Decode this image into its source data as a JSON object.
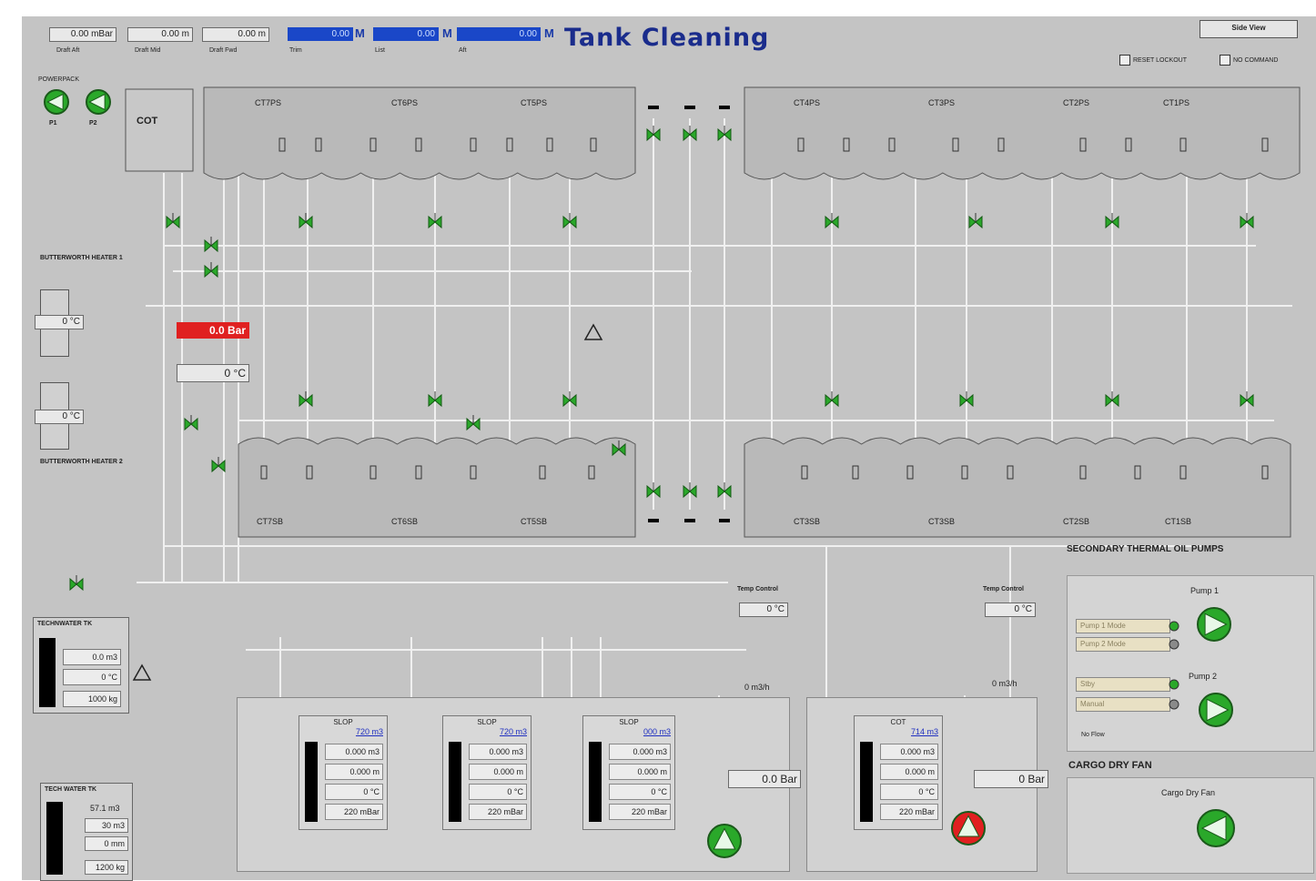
{
  "title": "Tank Cleaning",
  "header": {
    "draft_fields": [
      {
        "value": "0.00 mBar",
        "label": "Draft Aft"
      },
      {
        "value": "0.00 m",
        "label": "Draft Mid"
      },
      {
        "value": "0.00 m",
        "label": "Draft Fwd"
      }
    ],
    "trim_bars": [
      {
        "value": "0.00",
        "unit": "M",
        "label": "Trim"
      },
      {
        "value": "0.00",
        "unit": "M",
        "label": "List"
      },
      {
        "value": "0.00",
        "unit": "M",
        "label": "Aft"
      }
    ],
    "side_view_button": "Side View",
    "reset_lockout": "RESET LOCKOUT",
    "no_command": "NO COMMAND"
  },
  "powerpack": {
    "label": "POWERPACK",
    "pumps": [
      "P1",
      "P2"
    ]
  },
  "cot_label": "COT",
  "upper_tanks": [
    "CT7PS",
    "CT6PS",
    "CT5PS",
    "CT4PS",
    "CT3PS",
    "CT2PS",
    "CT1PS"
  ],
  "lower_tanks": [
    "CT7SB",
    "CT6SB",
    "CT5SB",
    "CT3SB",
    "CT3SB",
    "CT2SB",
    "CT1SB"
  ],
  "butterworth_1": {
    "title": "BUTTERWORTH HEATER 1",
    "temp": "0 °C"
  },
  "butterworth_2": {
    "title": "BUTTERWORTH HEATER 2",
    "temp": "0 °C"
  },
  "pressure_alarm": "0.0 Bar",
  "temp_reading": "0 °C",
  "tech_water_tank": {
    "title": "TECHNWATER TK",
    "values": [
      "0.0 m3",
      "0 °C",
      "1000 kg"
    ]
  },
  "tech_water_tank_2": {
    "title": "TECH WATER TK",
    "values": [
      "57.1 m3",
      "30 m3",
      "0 mm",
      "1200 kg"
    ]
  },
  "temp_control_1": {
    "label": "Temp Control",
    "value": "0 °C"
  },
  "temp_control_2": {
    "label": "Temp Control",
    "value": "0 °C"
  },
  "flow_1": "0 m3/h",
  "flow_2": "0 m3/h",
  "slop_tanks": [
    {
      "name": "SLOP",
      "volume": "720 m3",
      "values": [
        "0.000 m3",
        "0.000 m",
        "0 °C",
        "220 mBar"
      ]
    },
    {
      "name": "SLOP",
      "volume": "720 m3",
      "values": [
        "0.000 m3",
        "0.000 m",
        "0 °C",
        "220 mBar"
      ]
    },
    {
      "name": "SLOP",
      "volume": "000 m3",
      "values": [
        "0.000 m3",
        "0.000 m",
        "0 °C",
        "220 mBar"
      ]
    },
    {
      "name": "COT",
      "volume": "714 m3",
      "values": [
        "0.000 m3",
        "0.000 m",
        "0 °C",
        "220 mBar"
      ]
    }
  ],
  "pump_pressure_1": "0.0 Bar",
  "pump_pressure_2": "0 Bar",
  "secondary_pumps": {
    "title": "SECONDARY THERMAL OIL PUMPS",
    "pump1_label": "Pump 1",
    "pump2_label": "Pump 2",
    "mode_labels": [
      "Pump 1 Mode",
      "Pump 2 Mode"
    ],
    "mode2_labels": [
      "Stby",
      "Manual"
    ],
    "status": "No Flow"
  },
  "cargo_dry_fan": {
    "title": "CARGO DRY FAN",
    "label": "Cargo Dry Fan"
  },
  "colors": {
    "panel": "#c4c4c4",
    "pipe": "#eeeeee",
    "valve": "#2aa82a",
    "alarm": "#e02020",
    "blue": "#1a47c8"
  }
}
